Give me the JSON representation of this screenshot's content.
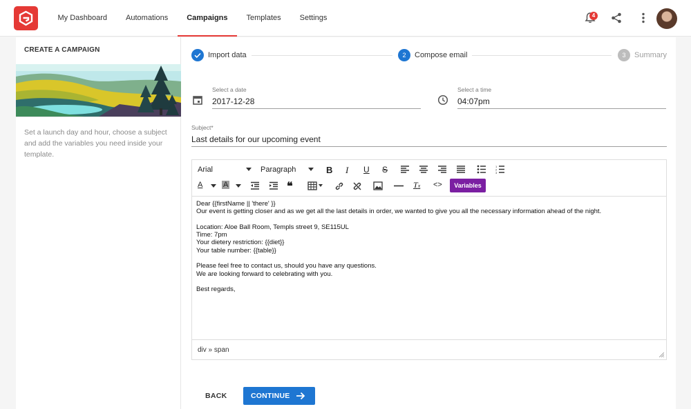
{
  "nav": {
    "items": [
      {
        "label": "My Dashboard",
        "active": false
      },
      {
        "label": "Automations",
        "active": false
      },
      {
        "label": "Campaigns",
        "active": true
      },
      {
        "label": "Templates",
        "active": false
      },
      {
        "label": "Settings",
        "active": false
      }
    ],
    "notification_count": "4",
    "accent_color": "#e53935"
  },
  "sidebar": {
    "title": "CREATE A CAMPAIGN",
    "description": "Set a launch day and hour, choose a subject and add the variables you need inside your template."
  },
  "stepper": {
    "steps": [
      {
        "number": "1",
        "label": "Import data",
        "state": "completed"
      },
      {
        "number": "2",
        "label": "Compose email",
        "state": "active"
      },
      {
        "number": "3",
        "label": "Summary",
        "state": "pending"
      }
    ],
    "active_color": "#1e76d2"
  },
  "form": {
    "date_label": "Select a date",
    "date_value": "2017-12-28",
    "time_label": "Select a time",
    "time_value": "04:07pm",
    "subject_label": "Subject*",
    "subject_value": "Last details for our upcoming event"
  },
  "editor": {
    "font_family": "Arial",
    "block_format": "Paragraph",
    "variables_label": "Variables",
    "variables_color": "#7b1fa2",
    "body_lines": [
      "Dear {{firstName || 'there' }}",
      "Our event is getting closer and as we get all the last details in order, we wanted to give you all the necessary information ahead of the night.",
      "",
      "Location: Aloe Ball Room, Templs street 9, SE115UL",
      "Time: 7pm",
      "Your dietery restriction: {{diet}}",
      "Your table number: {{table}}",
      "",
      "Please feel free to contact us, should you have any questions.",
      "We are looking forward to celebrating with you.",
      "",
      "Best regards,"
    ],
    "path": "div » span"
  },
  "actions": {
    "back_label": "BACK",
    "continue_label": "CONTINUE"
  }
}
